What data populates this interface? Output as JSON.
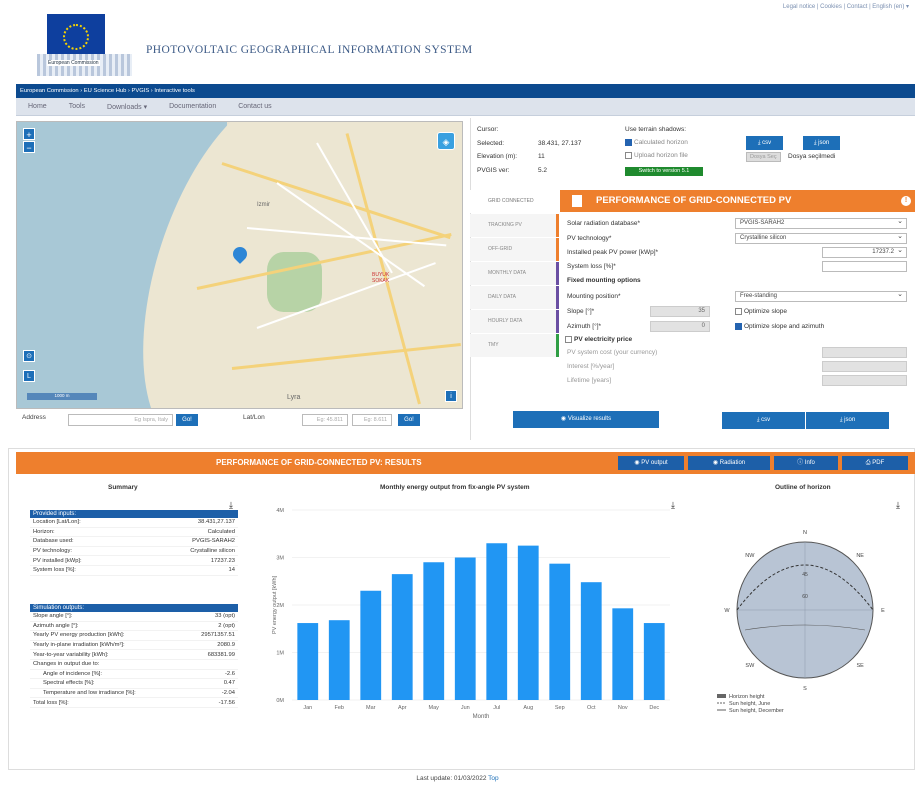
{
  "header": {
    "toplinks": "Legal notice | Cookies | Contact | English (en) ▾",
    "logo_text": "European Commission",
    "system_name": "PHOTOVOLTAIC GEOGRAPHICAL INFORMATION SYSTEM",
    "breadcrumb": "European Commission › EU Science Hub › PVGIS › Interactive tools"
  },
  "nav": {
    "items": [
      "Home",
      "Tools",
      "Downloads ▾",
      "Documentation",
      "Contact us"
    ]
  },
  "map": {
    "labels": [
      "BUYUK\nSOKAK",
      "Lyra",
      "Izmir"
    ],
    "address_label": "Address",
    "address_placeholder": "Eg Ispra, Italy",
    "go_label": "Go!",
    "latlon_label": "Lat/Lon",
    "lat_placeholder": "Eg: 45.811",
    "lon_placeholder": "Eg: 8.611",
    "scale_text": "1000 m"
  },
  "cursor": {
    "cursor_label": "Cursor:",
    "selected_label": "Selected:",
    "selected_value": "38.431, 27.137",
    "elevation_label": "Elevation (m):",
    "elevation_value": "11",
    "pvgis_label": "PVGIS ver:",
    "pvgis_value": "5.2",
    "switch_label": "Switch to version 5.1",
    "shadows_label": "Use terrain shadows:",
    "calc_horizon": "Calculated horizon",
    "upload_horizon": "Upload horizon file",
    "csv_label": "csv",
    "json_label": "json",
    "choose_file": "Dosya Seç",
    "no_file": "Dosya seçilmedi"
  },
  "tabs": [
    "GRID CONNECTED",
    "TRACKING PV",
    "OFF-GRID",
    "MONTHLY DATA",
    "DAILY DATA",
    "HOURLY DATA",
    "TMY"
  ],
  "form": {
    "title": "PERFORMANCE OF GRID-CONNECTED PV",
    "db_label": "Solar radiation database*",
    "db_value": "PVGIS-SARAH2",
    "tech_label": "PV technology*",
    "tech_value": "Crystalline silicon",
    "peak_label": "Installed peak PV power [kWp]*",
    "peak_value": "17237.2",
    "loss_label": "System loss [%]*",
    "loss_value": "14",
    "fixed_label": "Fixed mounting options",
    "mount_label": "Mounting position*",
    "mount_value": "Free-standing",
    "slope_label": "Slope [°]*",
    "slope_value": "35",
    "azimuth_label": "Azimuth [°]*",
    "azimuth_value": "0",
    "opt_slope": "Optimize slope",
    "opt_both": "Optimize slope and azimuth",
    "price_label": "PV electricity price",
    "cost_label": "PV system cost (your currency)",
    "interest_label": "Interest [%/year]",
    "lifetime_label": "Lifetime [years]",
    "visualize": "Visualize results",
    "csv": "csv",
    "json": "json"
  },
  "results": {
    "title": "PERFORMANCE OF GRID-CONNECTED PV: RESULTS",
    "buttons": [
      "PV output",
      "Radiation",
      "Info",
      "PDF"
    ],
    "summary_title": "Summary",
    "chart_title": "Monthly energy output from fix-angle PV system",
    "horizon_title": "Outline of horizon",
    "provided_inputs": "Provided inputs:",
    "inputs": [
      [
        "Location [Lat/Lon]:",
        "38.431,27.137"
      ],
      [
        "Horizon:",
        "Calculated"
      ],
      [
        "Database used:",
        "PVGIS-SARAH2"
      ],
      [
        "PV technology:",
        "Crystalline silicon"
      ],
      [
        "PV installed [kWp]:",
        "17237.23"
      ],
      [
        "System loss [%]:",
        "14"
      ]
    ],
    "sim_outputs": "Simulation outputs:",
    "outputs": [
      [
        "Slope angle [°]:",
        "33 (opt)"
      ],
      [
        "Azimuth angle [°]:",
        "2 (opt)"
      ],
      [
        "Yearly PV energy production [kWh]:",
        "29571357.51"
      ],
      [
        "Yearly in-plane irradiation [kWh/m²]:",
        "2080.9"
      ],
      [
        "Year-to-year variability [kWh]:",
        "683381.99"
      ],
      [
        "Changes in output due to:",
        ""
      ],
      [
        "  Angle of incidence [%]:",
        "-2.6"
      ],
      [
        "  Spectral effects [%]:",
        "0.47"
      ],
      [
        "  Temperature and low irradiance [%]:",
        "-2.04"
      ],
      [
        "Total loss [%]:",
        "-17.56"
      ]
    ]
  },
  "chart_data": {
    "type": "bar",
    "title": "Monthly energy output from fix-angle PV system",
    "xlabel": "Month",
    "ylabel": "PV energy output [kWh]",
    "categories": [
      "Jan",
      "Feb",
      "Mar",
      "Apr",
      "May",
      "Jun",
      "Jul",
      "Aug",
      "Sep",
      "Oct",
      "Nov",
      "Dec"
    ],
    "values": [
      1.62,
      1.68,
      2.3,
      2.65,
      2.9,
      3.0,
      3.3,
      3.25,
      2.87,
      2.48,
      1.93,
      1.62
    ],
    "ylim": [
      0,
      4
    ],
    "yticks": [
      "0M",
      "1M",
      "2M",
      "3M",
      "4M"
    ],
    "color": "#2196f3"
  },
  "horizon": {
    "directions": [
      "N",
      "NE",
      "E",
      "SE",
      "S",
      "SW",
      "W",
      "NW"
    ],
    "rings": [
      "45",
      "60"
    ],
    "legend": [
      "Horizon height",
      "Sun height, June",
      "Sun height, December"
    ]
  },
  "footer": {
    "text": "Last update: 01/03/2022",
    "top": "Top"
  }
}
